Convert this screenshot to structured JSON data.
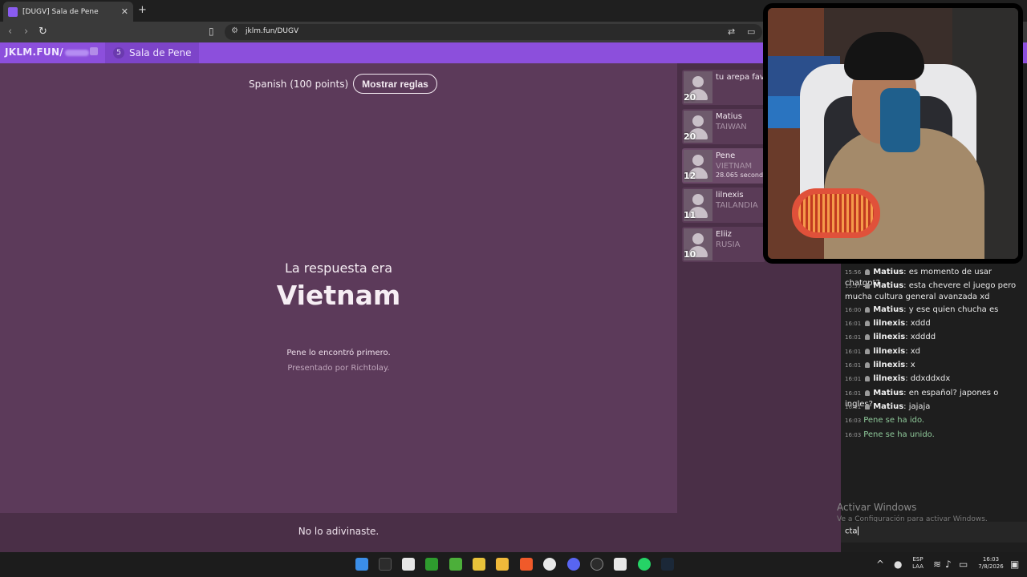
{
  "browser": {
    "tab_title": "[DUGV] Sala de Pene",
    "tab_close": "✕",
    "new_tab": "+",
    "url": "jklm.fun/DUGV"
  },
  "site": {
    "logo": "JKLM.FUN/",
    "room_count": "5",
    "room_name": "Sala de Pene"
  },
  "game": {
    "language_label": "Spanish (100 points)",
    "rules_button": "Mostrar reglas",
    "answer_intro": "La respuesta era",
    "answer": "Vietnam",
    "found_first": "Pene lo encontró primero.",
    "presented_by": "Presentado por Richtolay.",
    "bottom_message": "No lo adivinaste."
  },
  "players": [
    {
      "score": "20",
      "name": "tu arepa fav",
      "country": "",
      "time": ""
    },
    {
      "score": "20",
      "name": "Matius",
      "country": "TAIWAN",
      "time": ""
    },
    {
      "score": "12",
      "name": "Pene",
      "country": "VIETNAM",
      "time": "28.065 second"
    },
    {
      "score": "11",
      "name": "lilnexis",
      "country": "TAILANDIA",
      "time": ""
    },
    {
      "score": "10",
      "name": "Eliiz",
      "country": "RUSIA",
      "time": ""
    }
  ],
  "chat": {
    "messages": [
      {
        "time": "15:56",
        "user": "Matius",
        "text": ": es momento de usar chatgpt?"
      },
      {
        "time": "15:57",
        "user": "Matius",
        "text": ": esta chevere el juego pero mucha cultura general avanzada xd"
      },
      {
        "time": "16:00",
        "user": "Matius",
        "text": ": y ese quien chucha es"
      },
      {
        "time": "16:01",
        "user": "lilnexis",
        "text": ": xddd"
      },
      {
        "time": "16:01",
        "user": "lilnexis",
        "text": ": xdddd"
      },
      {
        "time": "16:01",
        "user": "lilnexis",
        "text": ": xd"
      },
      {
        "time": "16:01",
        "user": "lilnexis",
        "text": ": x"
      },
      {
        "time": "16:01",
        "user": "lilnexis",
        "text": ": ddxddxdx"
      },
      {
        "time": "16:01",
        "user": "Matius",
        "text": ": en español? japones o ingles?"
      },
      {
        "time": "16:01",
        "user": "Matius",
        "text": ": jajaja"
      }
    ],
    "system_messages": [
      {
        "time": "16:03",
        "text": "Pene se ha ido."
      },
      {
        "time": "16:03",
        "text": "Pene se ha unido."
      }
    ],
    "input_value": "cta"
  },
  "windows_activation": {
    "title": "Activar Windows",
    "subtitle": "Ve a Configuración para activar Windows."
  },
  "taskbar": {
    "language": "ESP",
    "layout": "LAA",
    "time": "16:03",
    "date": "7/8/2026"
  }
}
